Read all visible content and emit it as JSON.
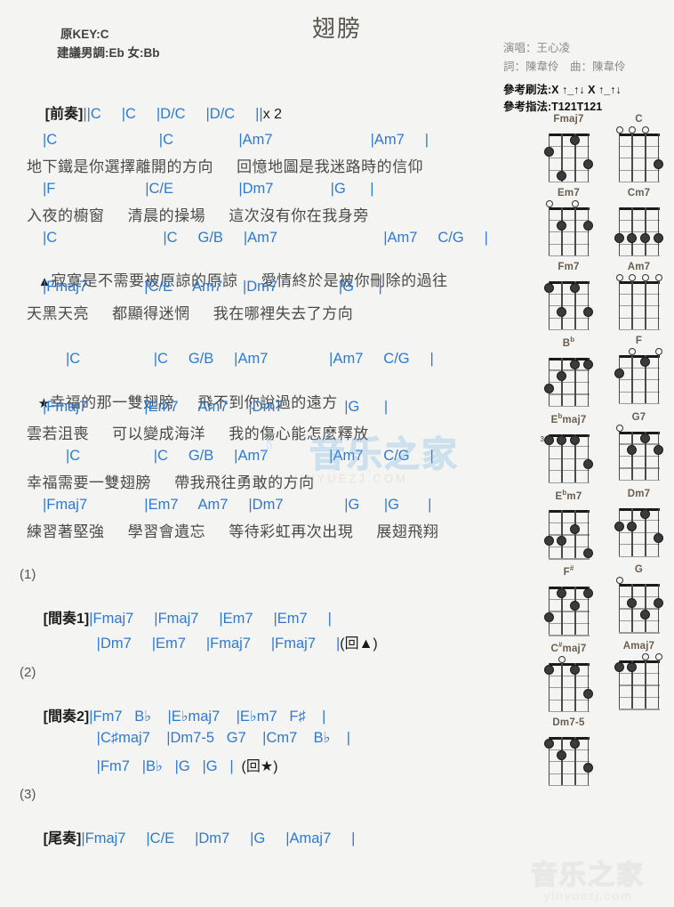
{
  "header": {
    "title": "翅膀",
    "original_key": "原KEY:C",
    "suggested_key": "建議男調:Eb 女:Bb",
    "singer": "演唱：王心凌",
    "writers": "詞：陳韋伶　曲：陳韋伶",
    "strum_pattern": "參考刷法:X ↑_↑↓ X ↑_↑↓",
    "finger_pattern": "參考指法:T121T121"
  },
  "sections": {
    "intro": {
      "label": "[前奏]",
      "chords": "||C     |C     |D/C     |D/C     ||",
      "repeat": "x 2"
    },
    "verse1": {
      "l1_chords": "|C                         |C                |Am7                        |Am7     |",
      "l1_lyrics": "地下鐵是你選擇離開的方向     回憶地圖是我迷路時的信仰",
      "l2_chords": "|F                      |C/E                |Dm7              |G      |",
      "l2_lyrics": "入夜的櫥窗     清晨的操場     這次沒有你在我身旁",
      "l3_chords": "|C                          |C     G/B     |Am7                          |Am7     C/G     |",
      "l3_marker": "▲",
      "l3_lyrics": "寂寞是不需要被原諒的原諒     愛情終於是被你刪除的過往",
      "l4_chords": "|Fmaj7              |C/E     Am7     |Dm7               |G      |",
      "l4_lyrics": "天黑天亮     都顯得迷惘     我在哪裡失去了方向"
    },
    "chorus": {
      "l1_chords": "|C                  |C     G/B     |Am7               |Am7     C/G     |",
      "l1_marker": "★",
      "l1_lyrics": "幸福的那一雙翅膀     飛不到你說過的遠方",
      "l2_chords": "|Fmaj7              |Em7     Am7     |Dm7               |G      |",
      "l2_lyrics": "雲若沮喪     可以變成海洋     我的傷心能怎麼釋放",
      "l3_chords": "|C                  |C     G/B     |Am7               |Am7     C/G     |",
      "l3_lyrics": "幸福需要一雙翅膀     帶我飛往勇敢的方向",
      "l4_chords": "|Fmaj7              |Em7     Am7     |Dm7               |G      |G       |",
      "l4_lyrics": "練習著堅強     學習會遺忘     等待彩虹再次出現     展翅飛翔"
    },
    "interlude1": {
      "tag": "(1)",
      "label": "[間奏1]",
      "line1": "|Fmaj7     |Fmaj7     |Em7     |Em7     |",
      "line2": "|Dm7     |Em7     |Fmaj7     |Fmaj7     |",
      "line2_note": "(回▲)"
    },
    "interlude2": {
      "tag": "(2)",
      "label": "[間奏2]",
      "line1_parts": [
        "|Fm7",
        "B♭",
        "|E♭maj7",
        "|E♭m7",
        "F♯",
        "|"
      ],
      "line2_parts": [
        "|C♯maj7",
        "|Dm7-5",
        "G7",
        "|Cm7",
        "B♭",
        "|"
      ],
      "line3_parts": [
        "|Fm7",
        "|B♭",
        "|G",
        "|G",
        "|"
      ],
      "line3_note": "(回★)"
    },
    "outro": {
      "tag": "(3)",
      "label": "[尾奏]",
      "line1": "|Fmaj7     |C/E     |Dm7     |G     |Amaj7     |"
    }
  },
  "watermark": {
    "center_cn": "音乐之家",
    "center_en": "YINYUEZJ.COM",
    "bottom_cn": "音乐之家",
    "bottom_en": "yinyuezj.com"
  },
  "chord_diagrams": [
    {
      "name": "Fmaj7",
      "open": [],
      "dots": [
        {
          "s": 4,
          "f": 2
        },
        {
          "s": 3,
          "f": 4
        },
        {
          "s": 2,
          "f": 1
        },
        {
          "s": 1,
          "f": 3
        }
      ],
      "start": null
    },
    {
      "name": "C",
      "open": [
        4,
        3,
        2
      ],
      "dots": [
        {
          "s": 1,
          "f": 3
        }
      ],
      "start": null
    },
    {
      "name": "Em7",
      "open": [
        4,
        2
      ],
      "dots": [
        {
          "s": 3,
          "f": 2
        },
        {
          "s": 1,
          "f": 2
        }
      ],
      "start": null
    },
    {
      "name": "Cm7",
      "open": [],
      "dots": [
        {
          "s": 4,
          "f": 3
        },
        {
          "s": 3,
          "f": 3
        },
        {
          "s": 2,
          "f": 3
        },
        {
          "s": 1,
          "f": 3
        }
      ],
      "start": null
    },
    {
      "name": "Fm7",
      "open": [],
      "dots": [
        {
          "s": 4,
          "f": 1
        },
        {
          "s": 2,
          "f": 1
        },
        {
          "s": 3,
          "f": 3
        },
        {
          "s": 1,
          "f": 3
        }
      ],
      "start": null
    },
    {
      "name": "Am7",
      "open": [
        4,
        3,
        2,
        1
      ],
      "dots": [],
      "start": null
    },
    {
      "name": "Bb",
      "open": [],
      "dots": [
        {
          "s": 2,
          "f": 1
        },
        {
          "s": 1,
          "f": 1
        },
        {
          "s": 3,
          "f": 2
        },
        {
          "s": 4,
          "f": 3
        }
      ],
      "start": null
    },
    {
      "name": "F",
      "open": [
        3,
        1
      ],
      "dots": [
        {
          "s": 2,
          "f": 1
        },
        {
          "s": 4,
          "f": 2
        }
      ],
      "start": null
    },
    {
      "name": "Ebmaj7",
      "open": [],
      "dots": [
        {
          "s": 4,
          "f": 1
        },
        {
          "s": 3,
          "f": 1
        },
        {
          "s": 2,
          "f": 1
        },
        {
          "s": 1,
          "f": 3
        }
      ],
      "start": "3"
    },
    {
      "name": "G7",
      "open": [
        4
      ],
      "dots": [
        {
          "s": 2,
          "f": 1
        },
        {
          "s": 3,
          "f": 2
        },
        {
          "s": 1,
          "f": 2
        }
      ],
      "start": null
    },
    {
      "name": "Ebm7",
      "open": [],
      "dots": [
        {
          "s": 2,
          "f": 2
        },
        {
          "s": 4,
          "f": 3
        },
        {
          "s": 3,
          "f": 3
        },
        {
          "s": 1,
          "f": 4
        }
      ],
      "start": null
    },
    {
      "name": "Dm7",
      "open": [],
      "dots": [
        {
          "s": 2,
          "f": 1
        },
        {
          "s": 4,
          "f": 2
        },
        {
          "s": 3,
          "f": 2
        },
        {
          "s": 1,
          "f": 3
        }
      ],
      "start": null
    },
    {
      "name": "F#",
      "open": [],
      "dots": [
        {
          "s": 3,
          "f": 1
        },
        {
          "s": 1,
          "f": 1
        },
        {
          "s": 2,
          "f": 2
        },
        {
          "s": 4,
          "f": 3
        }
      ],
      "start": null
    },
    {
      "name": "G",
      "open": [
        4
      ],
      "dots": [
        {
          "s": 3,
          "f": 2
        },
        {
          "s": 1,
          "f": 2
        },
        {
          "s": 2,
          "f": 3
        }
      ],
      "start": null
    },
    {
      "name": "C#maj7",
      "open": [
        3
      ],
      "dots": [
        {
          "s": 4,
          "f": 1
        },
        {
          "s": 2,
          "f": 1
        },
        {
          "s": 1,
          "f": 3
        }
      ],
      "start": null
    },
    {
      "name": "Amaj7",
      "open": [
        2,
        1
      ],
      "dots": [
        {
          "s": 4,
          "f": 1
        },
        {
          "s": 3,
          "f": 1
        }
      ],
      "start": null
    },
    {
      "name": "Dm7-5",
      "open": [],
      "dots": [
        {
          "s": 4,
          "f": 1
        },
        {
          "s": 2,
          "f": 1
        },
        {
          "s": 3,
          "f": 2
        },
        {
          "s": 1,
          "f": 3
        }
      ],
      "start": null
    }
  ]
}
